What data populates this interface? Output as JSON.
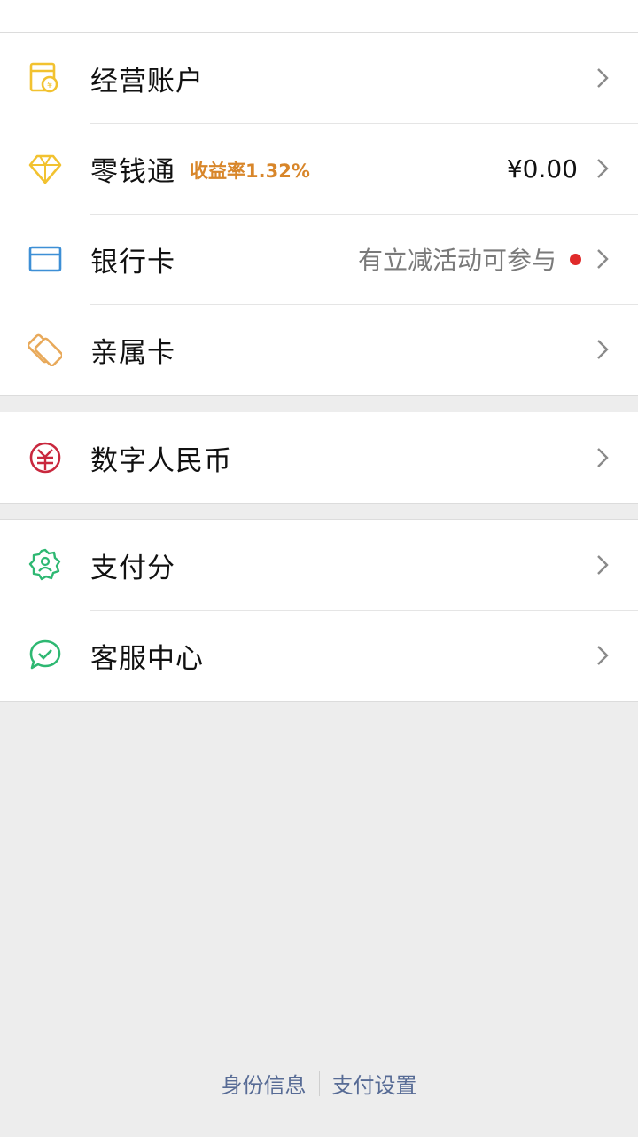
{
  "top_partial": {
    "icon": "coin-icon"
  },
  "wallet": {
    "items": [
      {
        "label": "经营账户",
        "icon": "business-account-icon"
      },
      {
        "label": "零钱通",
        "badge": "收益率1.32%",
        "value": "¥0.00",
        "icon": "diamond-icon"
      },
      {
        "label": "银行卡",
        "sub": "有立减活动可参与",
        "icon": "bank-card-icon"
      },
      {
        "label": "亲属卡",
        "icon": "family-card-icon"
      }
    ]
  },
  "digital": {
    "items": [
      {
        "label": "数字人民币",
        "icon": "digital-rmb-icon"
      }
    ]
  },
  "services": {
    "items": [
      {
        "label": "支付分",
        "icon": "pay-score-icon"
      },
      {
        "label": "客服中心",
        "icon": "customer-service-icon"
      }
    ]
  },
  "footer": {
    "identity": "身份信息",
    "settings": "支付设置"
  },
  "colors": {
    "accent_link": "#576b95",
    "badge": "#d8862a",
    "dot": "#e02a2a"
  }
}
